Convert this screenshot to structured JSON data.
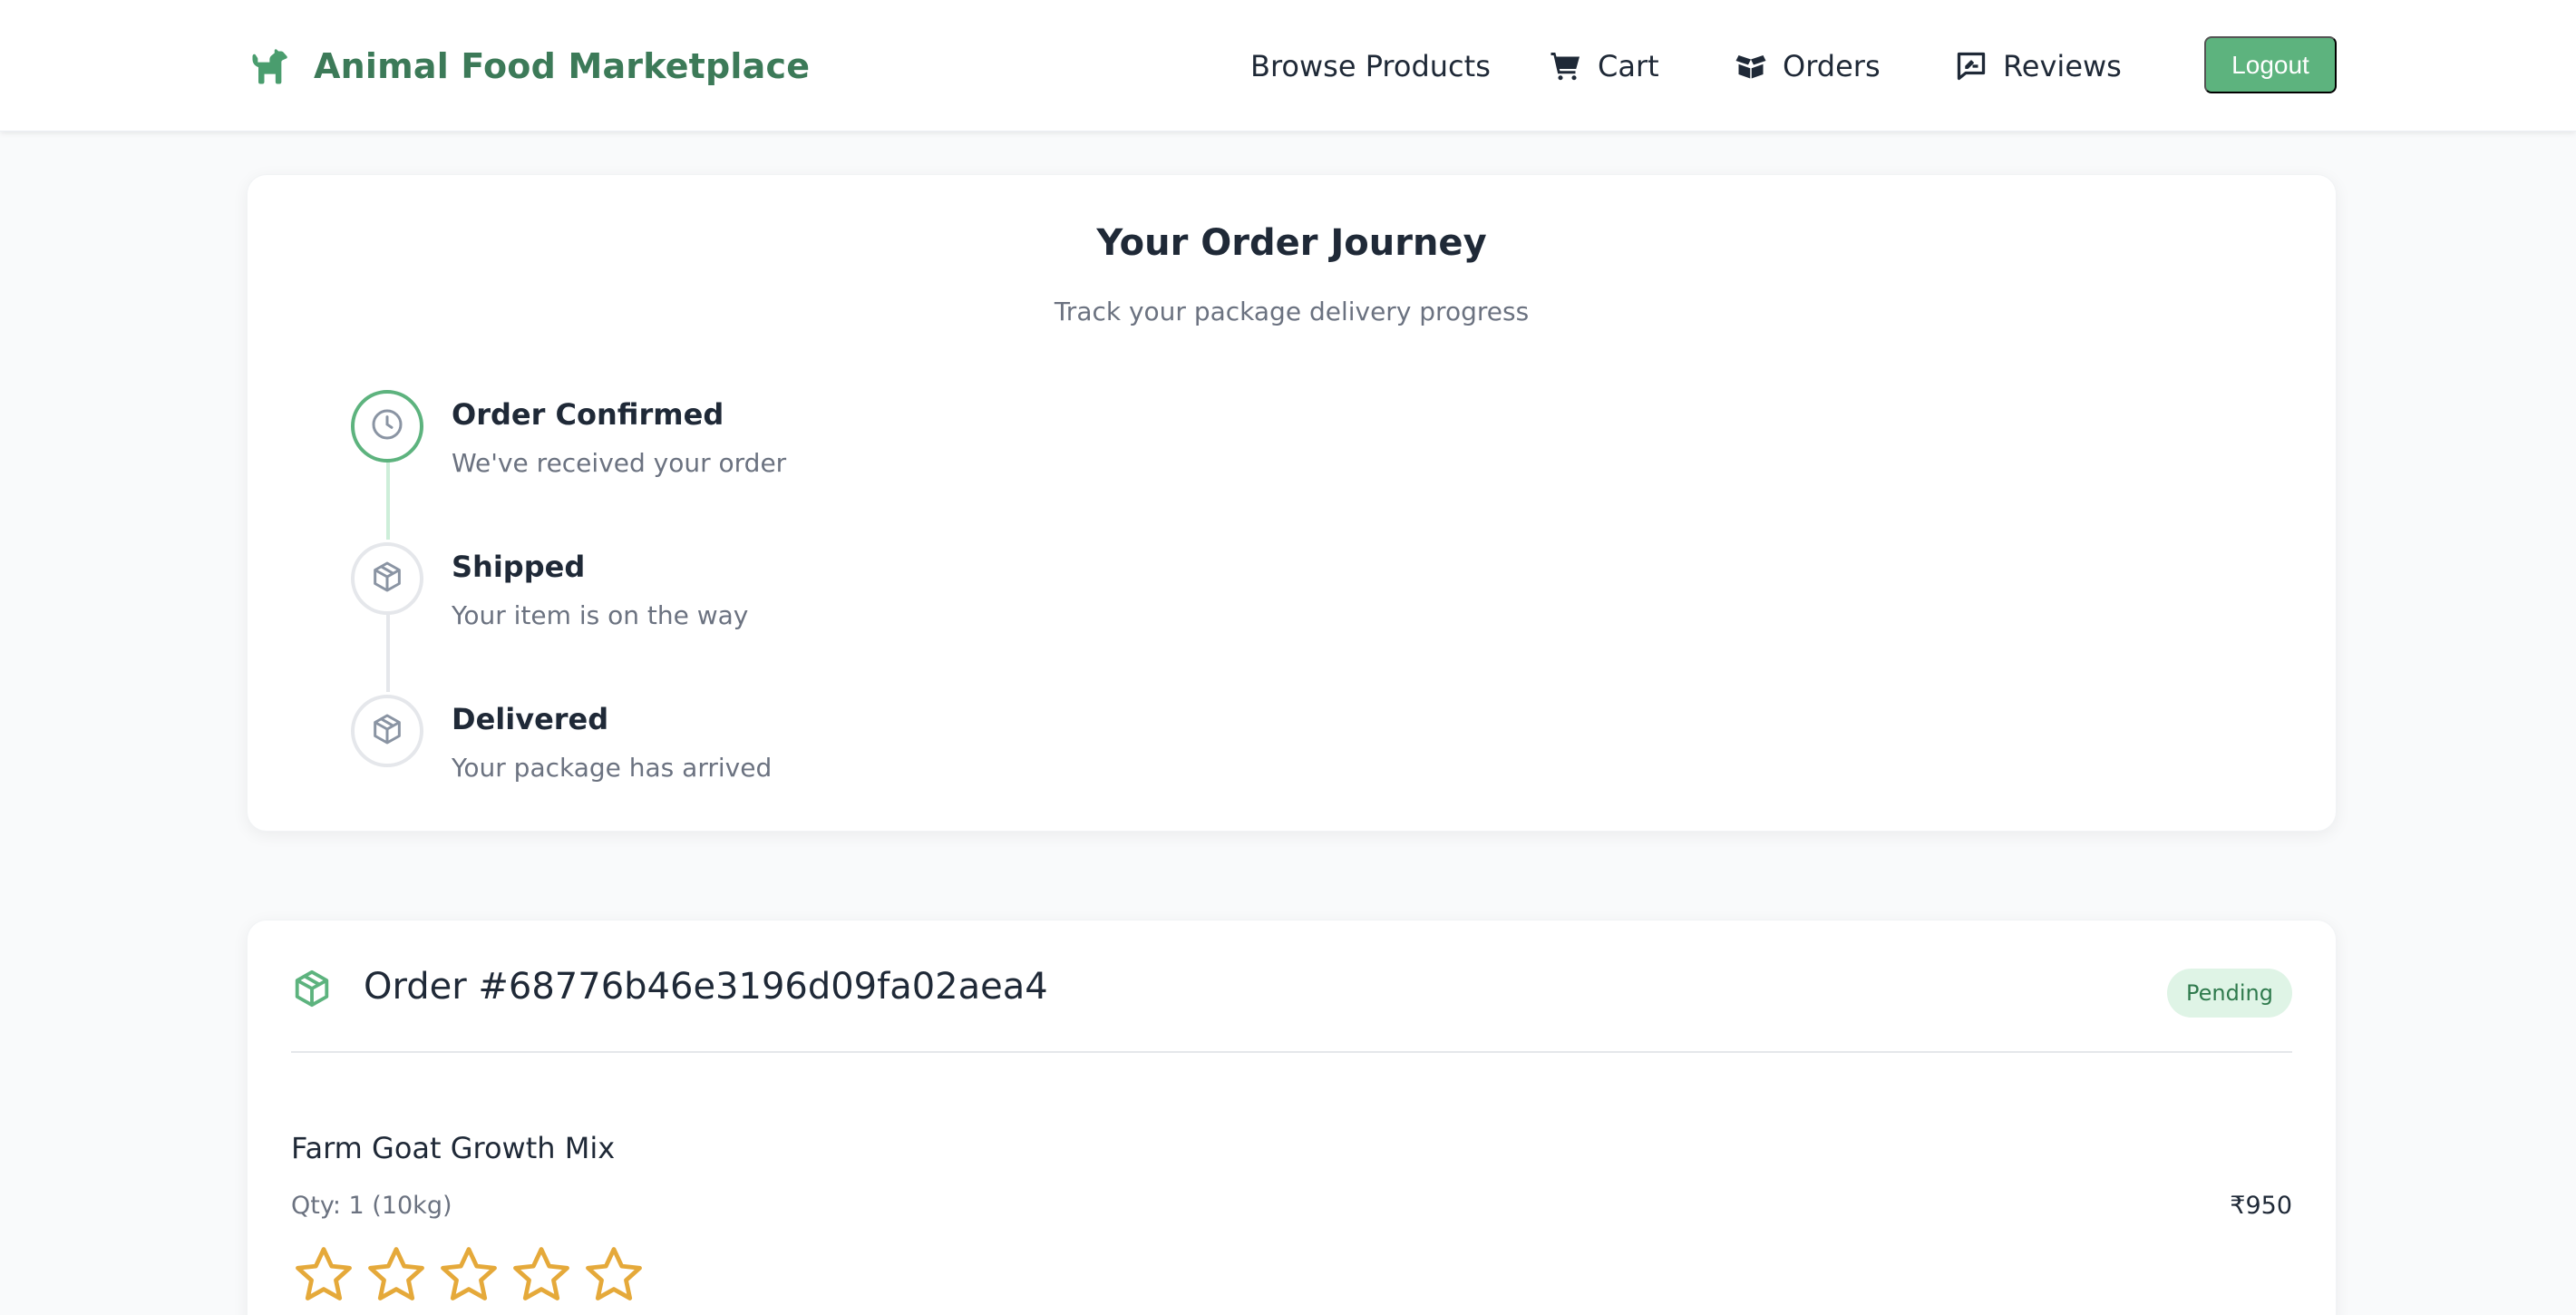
{
  "brand": {
    "title": "Animal Food Marketplace",
    "icon": "dog-icon"
  },
  "nav": {
    "browse": "Browse Products",
    "cart": "Cart",
    "orders": "Orders",
    "reviews": "Reviews",
    "logout": "Logout"
  },
  "journey": {
    "title": "Your Order Journey",
    "subtitle": "Track your package delivery progress",
    "steps": [
      {
        "title": "Order Confirmed",
        "desc": "We've received your order",
        "icon": "clock-icon",
        "state": "active"
      },
      {
        "title": "Shipped",
        "desc": "Your item is on the way",
        "icon": "package-icon",
        "state": "pending"
      },
      {
        "title": "Delivered",
        "desc": "Your package has arrived",
        "icon": "package-icon",
        "state": "pending"
      }
    ]
  },
  "order": {
    "id_label": "Order #68776b46e3196d09fa02aea4",
    "status": "Pending",
    "item": {
      "name": "Farm Goat Growth Mix",
      "qty": "Qty: 1 (10kg)",
      "price": "₹950",
      "rating": 0,
      "rating_max": 5
    }
  },
  "colors": {
    "accent": "#5db37e",
    "brand_text": "#3c7a58",
    "badge_bg": "#dff4e6",
    "star": "#e5a93a"
  }
}
